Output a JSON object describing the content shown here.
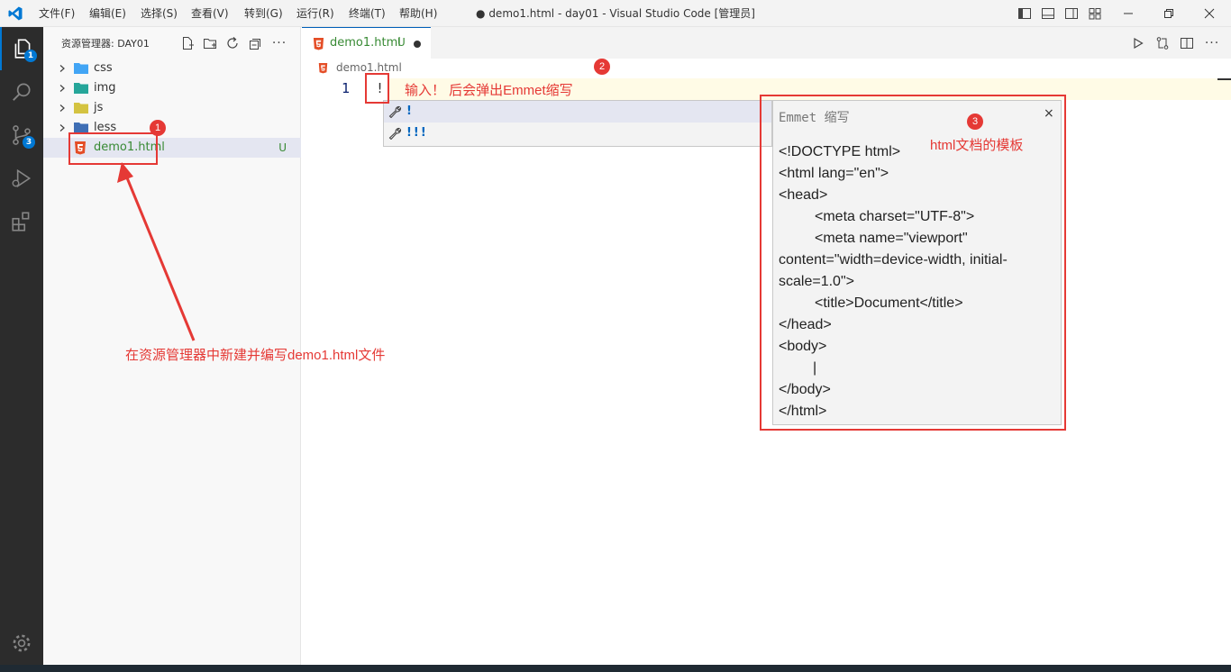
{
  "titlebar": {
    "menus": [
      "文件(F)",
      "编辑(E)",
      "选择(S)",
      "查看(V)",
      "转到(G)",
      "运行(R)",
      "终端(T)",
      "帮助(H)"
    ],
    "window_title": "● demo1.html - day01 - Visual Studio Code [管理员]"
  },
  "activitybar": {
    "explorer_badge": "1",
    "scm_badge": "3"
  },
  "sidebar": {
    "title": "资源管理器: DAY01",
    "items": [
      {
        "label": "css",
        "icon": "folder-css-icon"
      },
      {
        "label": "img",
        "icon": "folder-images-icon"
      },
      {
        "label": "js",
        "icon": "folder-js-icon"
      },
      {
        "label": "less",
        "icon": "folder-less-icon"
      },
      {
        "label": "demo1.html",
        "status": "U",
        "icon": "html5-icon"
      }
    ]
  },
  "editor": {
    "tab_label": "demo1.html",
    "tab_status": "U",
    "breadcrumb": "demo1.html",
    "line_number": "1",
    "line_text": "!"
  },
  "suggest": {
    "items": [
      "!",
      "!!!"
    ]
  },
  "details": {
    "title": "Emmet 缩写",
    "close": "×",
    "lines": [
      "<!DOCTYPE html>",
      "<html lang=\"en\">",
      "<head>",
      "<meta charset=\"UTF-8\">",
      "<meta name=\"viewport\"",
      "content=\"width=device-width, initial-",
      "scale=1.0\">",
      "<title>Document</title>",
      "</head>",
      "<body>",
      "|",
      "</body>",
      "</html>"
    ]
  },
  "annotations": {
    "badge1": "1",
    "badge2": "2",
    "badge3": "3",
    "note_input": "输入！ 后会弹出Emmet缩写",
    "note_template": "html文档的模板",
    "note_explorer": "在资源管理器中新建并编写demo1.html文件"
  },
  "colors": {
    "accent": "#0078d4",
    "annotation": "#e53935",
    "untracked": "#388a34"
  }
}
